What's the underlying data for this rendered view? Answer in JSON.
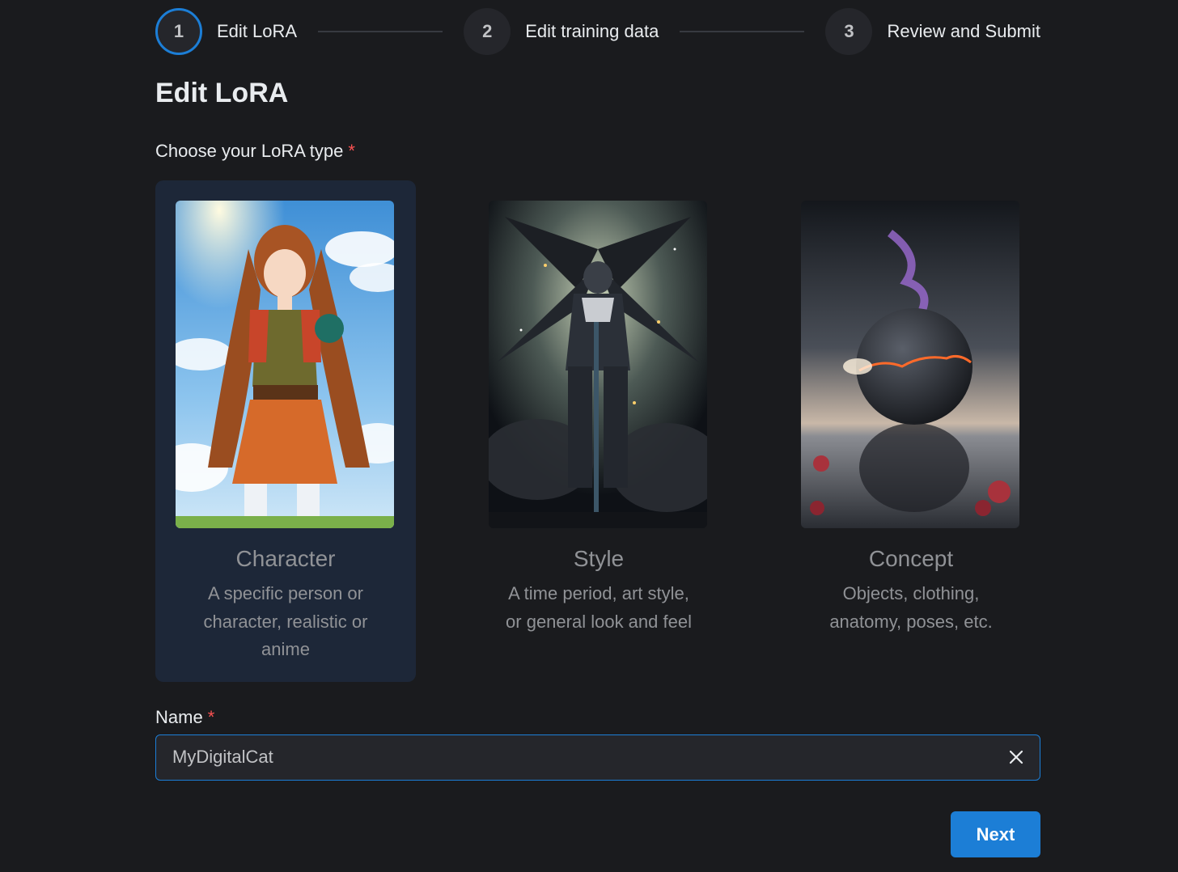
{
  "stepper": {
    "steps": [
      {
        "number": "1",
        "label": "Edit LoRA",
        "active": true
      },
      {
        "number": "2",
        "label": "Edit training data",
        "active": false
      },
      {
        "number": "3",
        "label": "Review and Submit",
        "active": false
      }
    ]
  },
  "page": {
    "title": "Edit LoRA"
  },
  "lora_type": {
    "label": "Choose your LoRA type",
    "required_mark": "*",
    "selected": "Character",
    "options": [
      {
        "title": "Character",
        "description": "A specific person or character, realistic or anime",
        "image": "anime-girl-illustration"
      },
      {
        "title": "Style",
        "description": "A time period, art style, or general look and feel",
        "image": "mecha-robot-illustration"
      },
      {
        "title": "Concept",
        "description": "Objects, clothing, anatomy, poses, etc.",
        "image": "planet-over-water-illustration"
      }
    ]
  },
  "name_field": {
    "label": "Name",
    "required_mark": "*",
    "value": "MyDigitalCat",
    "clear_icon": "close-icon"
  },
  "actions": {
    "next_label": "Next"
  },
  "colors": {
    "accent": "#1c7ed6",
    "required": "#fa5252",
    "background": "#1a1b1e",
    "selected_card": "#1d2738"
  }
}
